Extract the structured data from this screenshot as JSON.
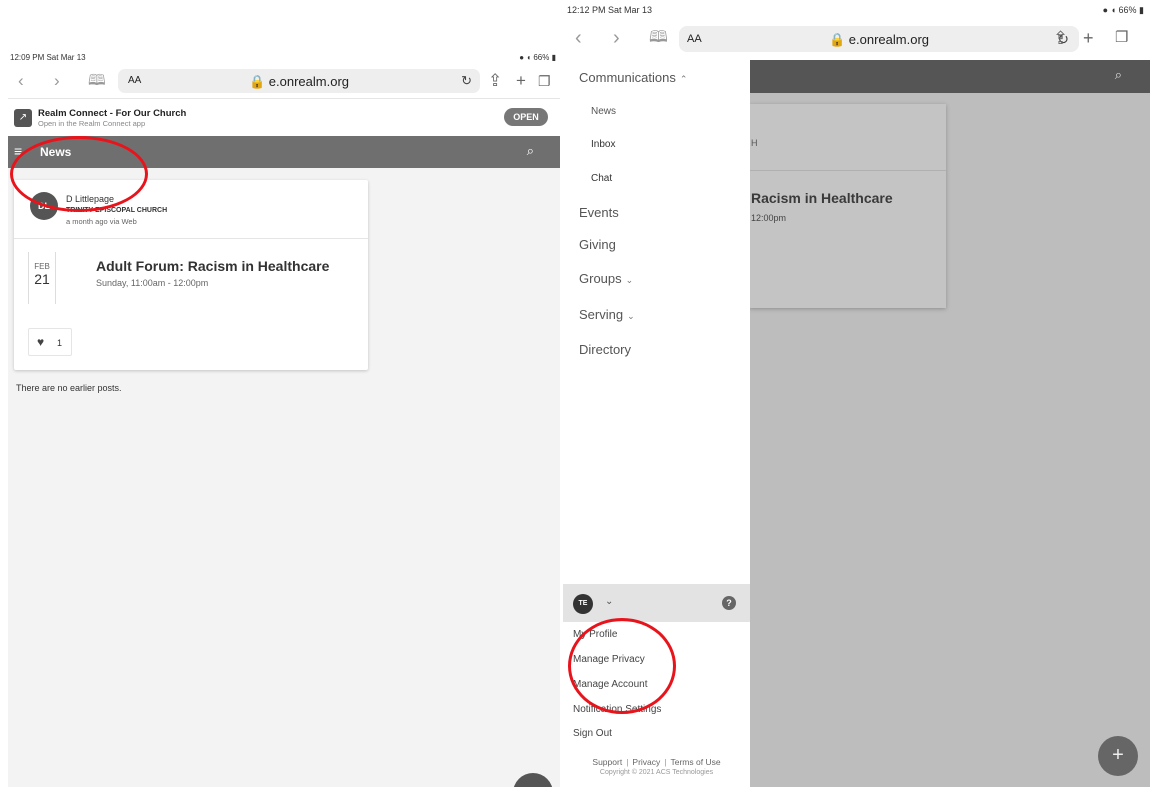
{
  "left": {
    "status": {
      "time": "12:09 PM  Sat Mar 13",
      "right": "● ◖ 66% ▮"
    },
    "browser": {
      "aa": "AA",
      "url": "e.onrealm.org",
      "lock": "lock-icon"
    },
    "app_banner": {
      "title": "Realm Connect - For Our Church",
      "subtitle": "Open in the Realm Connect app",
      "open_label": "OPEN"
    },
    "topbar": {
      "title": "News"
    },
    "post": {
      "avatar": "DL",
      "author": "D Littlepage",
      "church": "TRINITY EPISCOPAL CHURCH",
      "meta": "a month ago via Web",
      "event": {
        "month": "FEB",
        "day": "21",
        "title": "Adult Forum: Racism in Healthcare",
        "time": "Sunday, 11:00am - 12:00pm"
      },
      "likes": "1"
    },
    "no_more": "There are no earlier posts."
  },
  "right": {
    "status": {
      "time": "12:12 PM  Sat Mar 13",
      "right": "● ◖ 66% ▮"
    },
    "browser": {
      "aa": "AA",
      "url": "e.onrealm.org"
    },
    "nav": {
      "communications": "Communications",
      "news": "News",
      "inbox": "Inbox",
      "chat": "Chat",
      "events": "Events",
      "giving": "Giving",
      "groups": "Groups",
      "serving": "Serving",
      "directory": "Directory"
    },
    "profile": {
      "avatar": "TE"
    },
    "account_menu": [
      "My Profile",
      "Manage Privacy",
      "Manage Account",
      "Notification Settings",
      "Sign Out"
    ],
    "footer": {
      "support": "Support",
      "privacy": "Privacy",
      "terms": "Terms of Use",
      "copyright": "Copyright © 2021 ACS Technologies"
    },
    "background": {
      "frag1": "H",
      "frag2": "Racism in Healthcare",
      "frag3": "12:00pm"
    },
    "fab": "+"
  },
  "colors": {
    "annotation": "#e8141c",
    "topbar": "#6f6f6f",
    "drawer_profile_bar": "#e3e3e3"
  }
}
